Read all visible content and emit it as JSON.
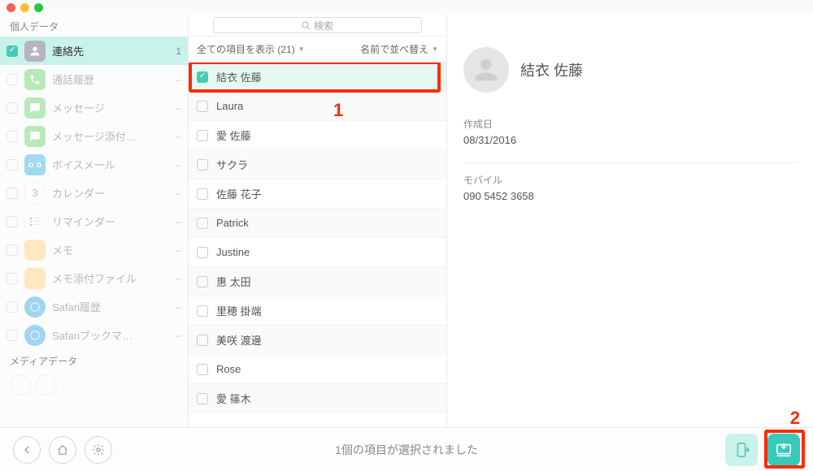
{
  "sidebar": {
    "section_personal": "個人データ",
    "section_media": "メディアデータ",
    "items": [
      {
        "label": "連絡先",
        "count": "1",
        "icon": "contacts",
        "color": "#b5b5c0"
      },
      {
        "label": "通話履歴",
        "count": "--",
        "icon": "phone",
        "color": "#68d46a"
      },
      {
        "label": "メッセージ",
        "count": "--",
        "icon": "message",
        "color": "#68d46a"
      },
      {
        "label": "メッセージ添付…",
        "count": "--",
        "icon": "attach",
        "color": "#68d46a"
      },
      {
        "label": "ボイスメール",
        "count": "--",
        "icon": "voicemail",
        "color": "#2fb3e9"
      },
      {
        "label": "カレンダー",
        "count": "--",
        "icon": "calendar",
        "color": "#fff"
      },
      {
        "label": "リマインダー",
        "count": "--",
        "icon": "reminder",
        "color": "#fff"
      },
      {
        "label": "メモ",
        "count": "--",
        "icon": "notes",
        "color": "#ffd27a"
      },
      {
        "label": "メモ添付ファイル",
        "count": "--",
        "icon": "notes2",
        "color": "#ffd27a"
      },
      {
        "label": "Safari履歴",
        "count": "--",
        "icon": "safari",
        "color": "#33a7e8"
      },
      {
        "label": "Safariブックマ…",
        "count": "--",
        "icon": "safari2",
        "color": "#33a7e8"
      }
    ]
  },
  "center": {
    "search_placeholder": "検索",
    "filter_all": "全ての項目を表示 (21)",
    "sort_label": "名前で並べ替え",
    "rows": [
      "結衣 佐藤",
      "Laura",
      "愛 佐藤",
      "サクラ",
      "佐藤 花子",
      "Patrick",
      "Justine",
      "惠 太田",
      "里穂 掛端",
      "美咲 渡邊",
      "Rose",
      "愛 篠木"
    ],
    "annotation_1": "1"
  },
  "detail": {
    "name": "結衣 佐藤",
    "created_label": "作成日",
    "created_value": "08/31/2016",
    "mobile_label": "モバイル",
    "mobile_value": "090 5452 3658"
  },
  "bottom": {
    "status": "1個の項目が選択されました",
    "annotation_2": "2"
  }
}
